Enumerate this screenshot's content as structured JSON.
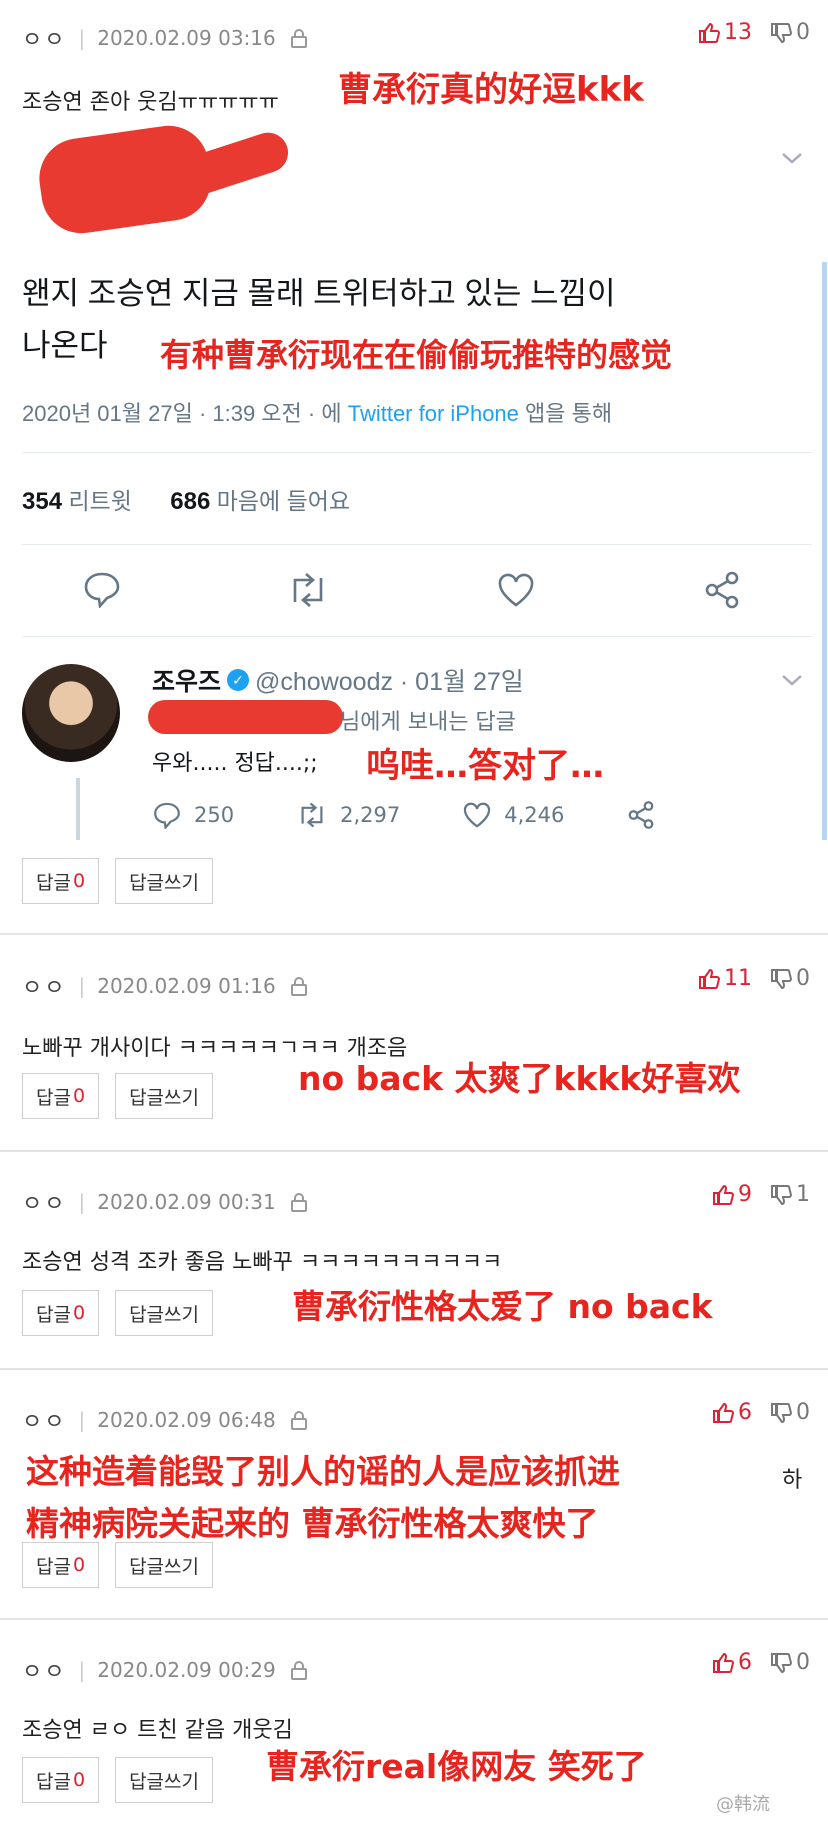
{
  "comments": [
    {
      "user": "ㅇㅇ",
      "date": "2020.02.09 03:16",
      "up": "13",
      "down": "0",
      "text": "조승연 존아 웃김ㅠㅠㅠㅠㅠ",
      "annotation": "曹承衍真的好逗kkk",
      "reply_label": "답글",
      "reply_count": "0",
      "write_label": "답글쓰기"
    },
    {
      "user": "ㅇㅇ",
      "date": "2020.02.09 01:16",
      "up": "11",
      "down": "0",
      "text": "노빠꾸 개사이다 ㅋㅋㅋㅋㅋㄱㅋㅋ 개조음",
      "annotation": "no back 太爽了kkkk好喜欢",
      "reply_label": "답글",
      "reply_count": "0",
      "write_label": "답글쓰기"
    },
    {
      "user": "ㅇㅇ",
      "date": "2020.02.09 00:31",
      "up": "9",
      "down": "1",
      "text": "조승연 성격 조카 좋음 노빠꾸 ㅋㅋㅋㅋㅋㅋㅋㅋㅋㅋ",
      "annotation": "曹承衍性格太爱了 no back",
      "reply_label": "답글",
      "reply_count": "0",
      "write_label": "답글쓰기"
    },
    {
      "user": "ㅇㅇ",
      "date": "2020.02.09 06:48",
      "up": "6",
      "down": "0",
      "text": "하",
      "annotation_line1": "这种造着能毁了别人的谣的人是应该抓进",
      "annotation_line2": "精神病院关起来的 曹承衍性格太爽快了",
      "reply_label": "답글",
      "reply_count": "0",
      "write_label": "답글쓰기"
    },
    {
      "user": "ㅇㅇ",
      "date": "2020.02.09 00:29",
      "up": "6",
      "down": "0",
      "text": "조승연 ㄹㅇ 트친 같음 개웃김",
      "annotation": "曹承衍real像网友 笑死了",
      "reply_label": "답글",
      "reply_count": "0",
      "write_label": "답글쓰기"
    }
  ],
  "tweet": {
    "text_line1": "왠지 조승연 지금 몰래 트위터하고 있는 느낌이",
    "text_line2": "나온다",
    "annotation": "有种曹承衍现在在偷偷玩推特的感觉",
    "date_prefix": "2020년 01월 27일 · 1:39 오전 · 에",
    "source": "Twitter for iPhone",
    "date_suffix": "앱을 통해",
    "retweets": "354",
    "retweets_label": "리트윗",
    "likes": "686",
    "likes_label": "마음에 들어요"
  },
  "reply": {
    "name": "조우즈",
    "handle": "@chowoodz · 01월 27일",
    "reply_to": "님에게 보내는 답글",
    "text": "우와..... 정답....;;",
    "annotation": "呜哇…答对了…",
    "replies": "250",
    "retweets": "2,297",
    "likes": "4,246"
  },
  "watermark": "@韩流",
  "colors": {
    "annotation": "#e8241e",
    "vote_up": "#dd2233",
    "twitter_blue": "#1da1f2"
  }
}
